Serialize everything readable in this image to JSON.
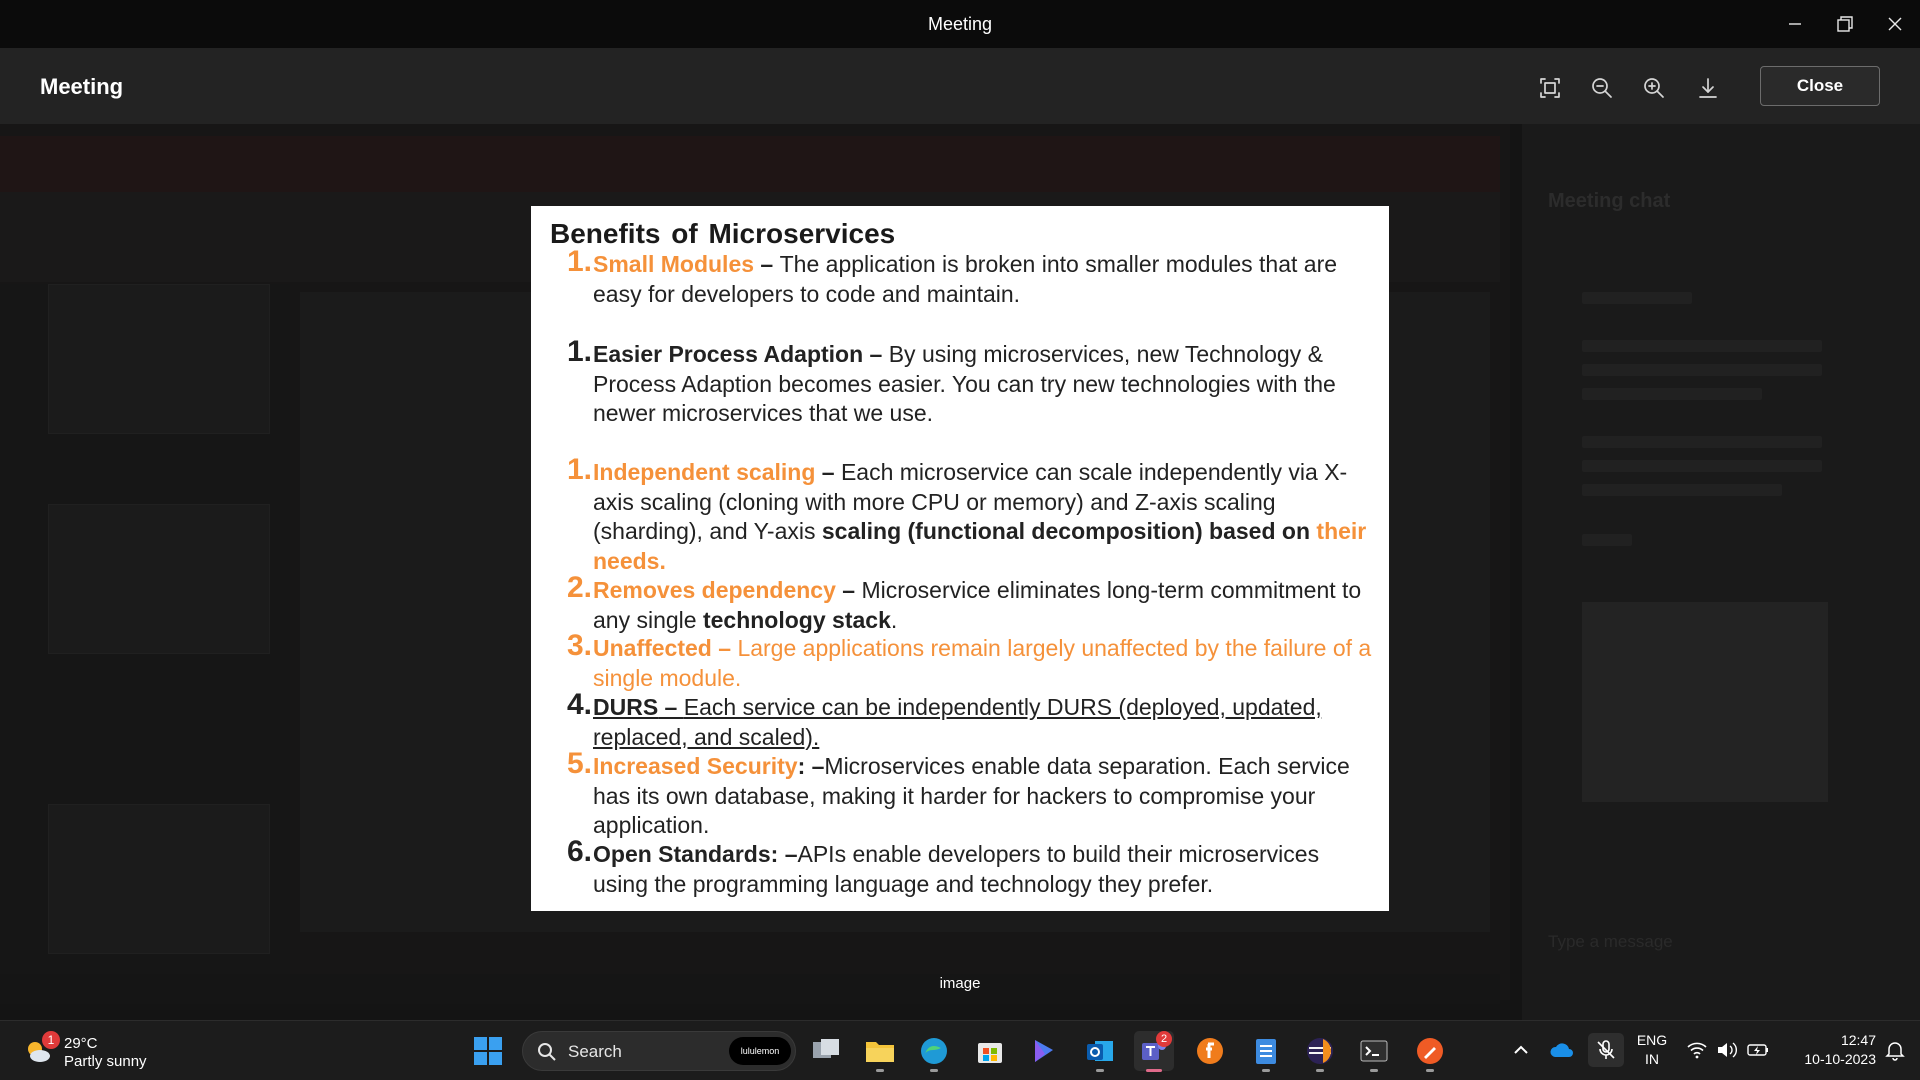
{
  "window": {
    "title": "Meeting"
  },
  "viewer": {
    "title": "Meeting",
    "close_label": "Close",
    "caption": "image"
  },
  "background": {
    "chat_title": "Meeting chat",
    "chat_input_placeholder": "Type a message"
  },
  "slide": {
    "title": "Benefits  of Microservices",
    "items": [
      {
        "num": "1.",
        "heading": "Small Modules",
        "dash": " – ",
        "text": "The application is broken into smaller modules that are easy for developers to code and maintain."
      },
      {
        "num": "1.",
        "heading": "Easier Process Adaption",
        "dash": " – ",
        "text": "By using microservices, new Technology & Process Adaption becomes easier. You can try new technologies with the newer microservices that we use."
      },
      {
        "num": "1.",
        "heading": "Independent scaling",
        "dash": " – ",
        "text": "Each microservice can scale independently via X-axis scaling (cloning with more CPU or memory) and Z-axis scaling (sharding), and Y-axis ",
        "bold_text": "scaling (functional decomposition) based on",
        "orange_text": " their needs."
      },
      {
        "num": "2.",
        "heading": "Removes dependency",
        "dash": " – ",
        "text": "Microservice eliminates long-term commitment to any single ",
        "bold_text": "technology stack",
        "tail": "."
      },
      {
        "num": "3.",
        "heading": "Unaffected",
        "dash": " – ",
        "text": "Large applications remain largely unaffected by the failure of a single module."
      },
      {
        "num": "4.",
        "heading": "DURS",
        "dash": " – ",
        "text": "Each service can be independently DURS (deployed, updated, replaced, and scaled)."
      },
      {
        "num": "5.",
        "heading": "Increased Security",
        "dash": ": –",
        "text": "Microservices enable data separation. Each service has its own database, making it harder for hackers to compromise your application."
      },
      {
        "num": "6.",
        "heading": "Open Standards",
        "dash": ": –",
        "text": "APIs enable developers to build their microservices using the programming language and technology they prefer."
      }
    ]
  },
  "taskbar": {
    "weather": {
      "badge": "1",
      "temp": "29°C",
      "desc": "Partly sunny",
      "icon": "partly-sunny-icon"
    },
    "search": {
      "label": "Search",
      "pill": "lululemon"
    },
    "teams_badge": "2",
    "lang_line1": "ENG",
    "lang_line2": "IN",
    "time": "12:47",
    "date": "10-10-2023"
  },
  "colors": {
    "accent_orange": "#f5913a",
    "titlebar": "#0b0b0b",
    "taskbar": "#1c1c1c"
  }
}
